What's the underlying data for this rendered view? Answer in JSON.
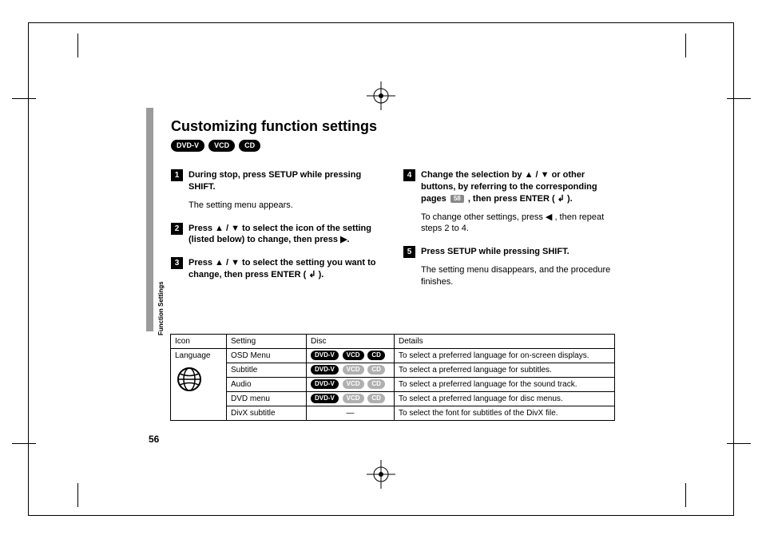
{
  "page": {
    "title": "Customizing function settings",
    "sidebar_label": "Function Settings",
    "page_number": "56"
  },
  "format_badges": {
    "dvd_v": "DVD-V",
    "vcd": "VCD",
    "cd": "CD"
  },
  "steps": [
    {
      "num": "1",
      "title": "During stop, press SETUP while pressing SHIFT.",
      "body": "The setting menu appears."
    },
    {
      "num": "2",
      "title": "Press ▲ / ▼ to select the icon of the setting (listed below) to change, then press ▶.",
      "body": ""
    },
    {
      "num": "3",
      "title": "Press ▲ / ▼ to select the setting you want to change, then press ENTER ( ↲ ).",
      "body": ""
    },
    {
      "num": "4",
      "title_pre": "Change the selection by ▲ / ▼ or other buttons, by referring to the corresponding pages ",
      "page_ref": "58",
      "title_post": " , then press ENTER ( ↲ ).",
      "body": "To change other settings, press ◀ , then repeat steps 2 to 4."
    },
    {
      "num": "5",
      "title": "Press SETUP while pressing SHIFT.",
      "body": "The setting menu disappears, and the procedure finishes."
    }
  ],
  "table": {
    "headers": {
      "icon": "Icon",
      "setting": "Setting",
      "disc": "Disc",
      "details": "Details"
    },
    "icon_label": "Language",
    "rows": [
      {
        "setting": "OSD Menu",
        "discs": [
          "DVD-V",
          "VCD",
          "CD"
        ],
        "disc_style": [
          "on",
          "on",
          "on"
        ],
        "details": "To select a preferred language for on-screen displays."
      },
      {
        "setting": "Subtitle",
        "discs": [
          "DVD-V",
          "VCD",
          "CD"
        ],
        "disc_style": [
          "on",
          "off",
          "off"
        ],
        "details": "To select a preferred language for subtitles."
      },
      {
        "setting": "Audio",
        "discs": [
          "DVD-V",
          "VCD",
          "CD"
        ],
        "disc_style": [
          "on",
          "off",
          "off"
        ],
        "details": "To select a preferred language for the sound track."
      },
      {
        "setting": "DVD menu",
        "discs": [
          "DVD-V",
          "VCD",
          "CD"
        ],
        "disc_style": [
          "on",
          "off",
          "off"
        ],
        "details": "To select a preferred language for disc menus."
      },
      {
        "setting": "DivX subtitle",
        "disc_text": "—",
        "details": "To select the font for subtitles of the DivX file."
      }
    ]
  }
}
